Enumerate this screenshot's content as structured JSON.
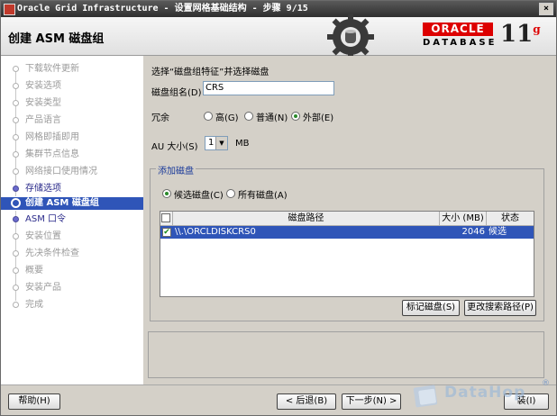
{
  "window": {
    "title": "Oracle Grid Infrastructure - 设置网格基础结构 - 步骤 9/15",
    "close_glyph": "×"
  },
  "header": {
    "page_title": "创建 ASM 磁盘组",
    "logo_oracle": "ORACLE",
    "logo_database": "DATABASE",
    "logo_version": "11",
    "logo_version_suffix": "g"
  },
  "sidebar": {
    "steps": [
      {
        "label": "下载软件更新",
        "state": "done"
      },
      {
        "label": "安装选项",
        "state": "done"
      },
      {
        "label": "安装类型",
        "state": "done"
      },
      {
        "label": "产品语言",
        "state": "done"
      },
      {
        "label": "网格即插即用",
        "state": "done"
      },
      {
        "label": "集群节点信息",
        "state": "done"
      },
      {
        "label": "网络接口使用情况",
        "state": "done"
      },
      {
        "label": "存储选项",
        "state": "link"
      },
      {
        "label": "创建 ASM 磁盘组",
        "state": "active"
      },
      {
        "label": "ASM 口令",
        "state": "link"
      },
      {
        "label": "安装位置",
        "state": "pending"
      },
      {
        "label": "先决条件检查",
        "state": "pending"
      },
      {
        "label": "概要",
        "state": "pending"
      },
      {
        "label": "安装产品",
        "state": "pending"
      },
      {
        "label": "完成",
        "state": "pending"
      }
    ]
  },
  "form": {
    "instruction": "选择“磁盘组特征”并选择磁盘",
    "diskgroup_label": "磁盘组名(D)",
    "diskgroup_value": "CRS",
    "redundancy_label": "冗余",
    "redundancy_options": [
      {
        "label": "高(G)",
        "selected": false
      },
      {
        "label": "普通(N)",
        "selected": false
      },
      {
        "label": "外部(E)",
        "selected": true
      }
    ],
    "au_label": "AU 大小(S)",
    "au_value": "1",
    "au_unit": "MB"
  },
  "add_disks": {
    "title": "添加磁盘",
    "filter_options": [
      {
        "label": "候选磁盘(C)",
        "selected": true
      },
      {
        "label": "所有磁盘(A)",
        "selected": false
      }
    ],
    "columns": [
      "",
      "磁盘路径",
      "大小 (MB)",
      "状态"
    ],
    "rows": [
      {
        "checked": true,
        "check_glyph": "✔",
        "path": "\\\\.\\ORCLDISKCRS0",
        "size": "2046",
        "status": "候选"
      }
    ],
    "mark_button": "标记磁盘(S)",
    "change_path_button": "更改搜索路径(P)"
  },
  "footer": {
    "help_button": "帮助(H)",
    "back_button": "< 后退(B)",
    "next_button": "下一步(N) >",
    "last_button": "装(I)"
  },
  "watermark": {
    "text": "DataHop",
    "reg_mark": "®"
  },
  "colors": {
    "selection": "#2f55b8",
    "oracle_red": "#dd0000",
    "link": "#2a2a8a",
    "group_title": "#1a3a9a"
  }
}
